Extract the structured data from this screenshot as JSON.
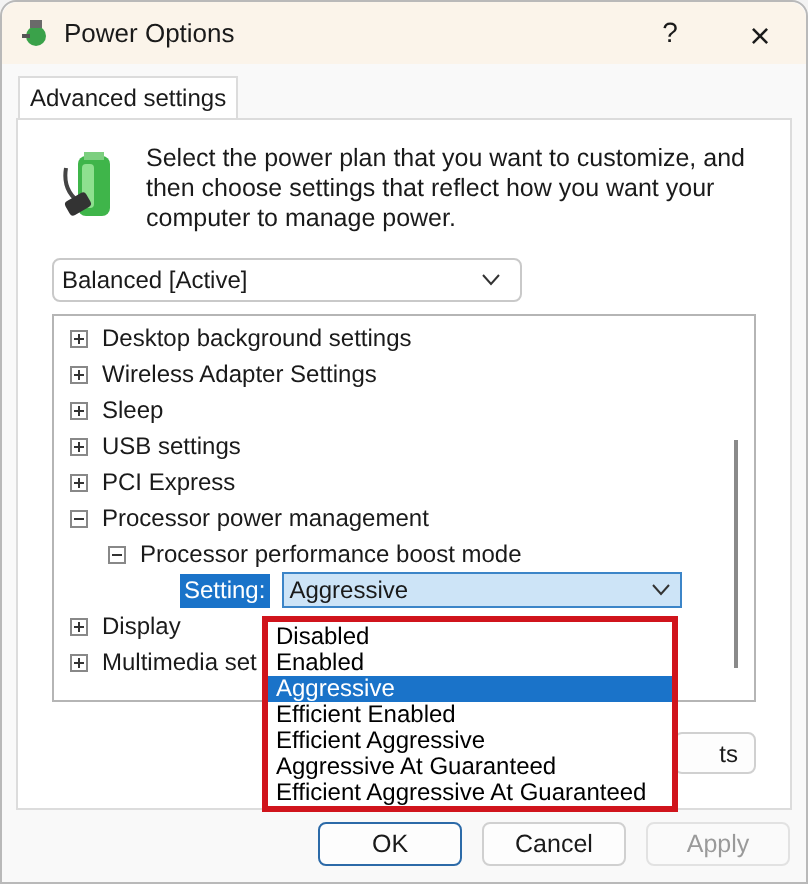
{
  "window": {
    "title": "Power Options",
    "help": "?",
    "close": "×"
  },
  "tabs": [
    {
      "label": "Advanced settings",
      "selected": true
    }
  ],
  "intro": "Select the power plan that you want to customize, and then choose settings that reflect how you want your computer to manage power.",
  "plan_select": {
    "value": "Balanced [Active]"
  },
  "tree": [
    {
      "label": "Desktop background settings",
      "expanded": false
    },
    {
      "label": "Wireless Adapter Settings",
      "expanded": false
    },
    {
      "label": "Sleep",
      "expanded": false
    },
    {
      "label": "USB settings",
      "expanded": false
    },
    {
      "label": "PCI Express",
      "expanded": false
    },
    {
      "label": "Processor power management",
      "expanded": true,
      "children": [
        {
          "label": "Processor performance boost mode",
          "expanded": true,
          "setting": {
            "label": "Setting:",
            "value": "Aggressive"
          }
        }
      ]
    },
    {
      "label": "Display",
      "expanded": false
    },
    {
      "label": "Multimedia set",
      "expanded": false
    }
  ],
  "dropdown_options": [
    {
      "label": "Disabled",
      "selected": false
    },
    {
      "label": "Enabled",
      "selected": false
    },
    {
      "label": "Aggressive",
      "selected": true
    },
    {
      "label": "Efficient Enabled",
      "selected": false
    },
    {
      "label": "Efficient Aggressive",
      "selected": false
    },
    {
      "label": "Aggressive At Guaranteed",
      "selected": false
    },
    {
      "label": "Efficient Aggressive At Guaranteed",
      "selected": false
    }
  ],
  "restore_button": "ts",
  "buttons": [
    {
      "label": "OK",
      "disabled": false,
      "default": true
    },
    {
      "label": "Cancel",
      "disabled": false,
      "default": false
    },
    {
      "label": "Apply",
      "disabled": true,
      "default": false
    }
  ]
}
